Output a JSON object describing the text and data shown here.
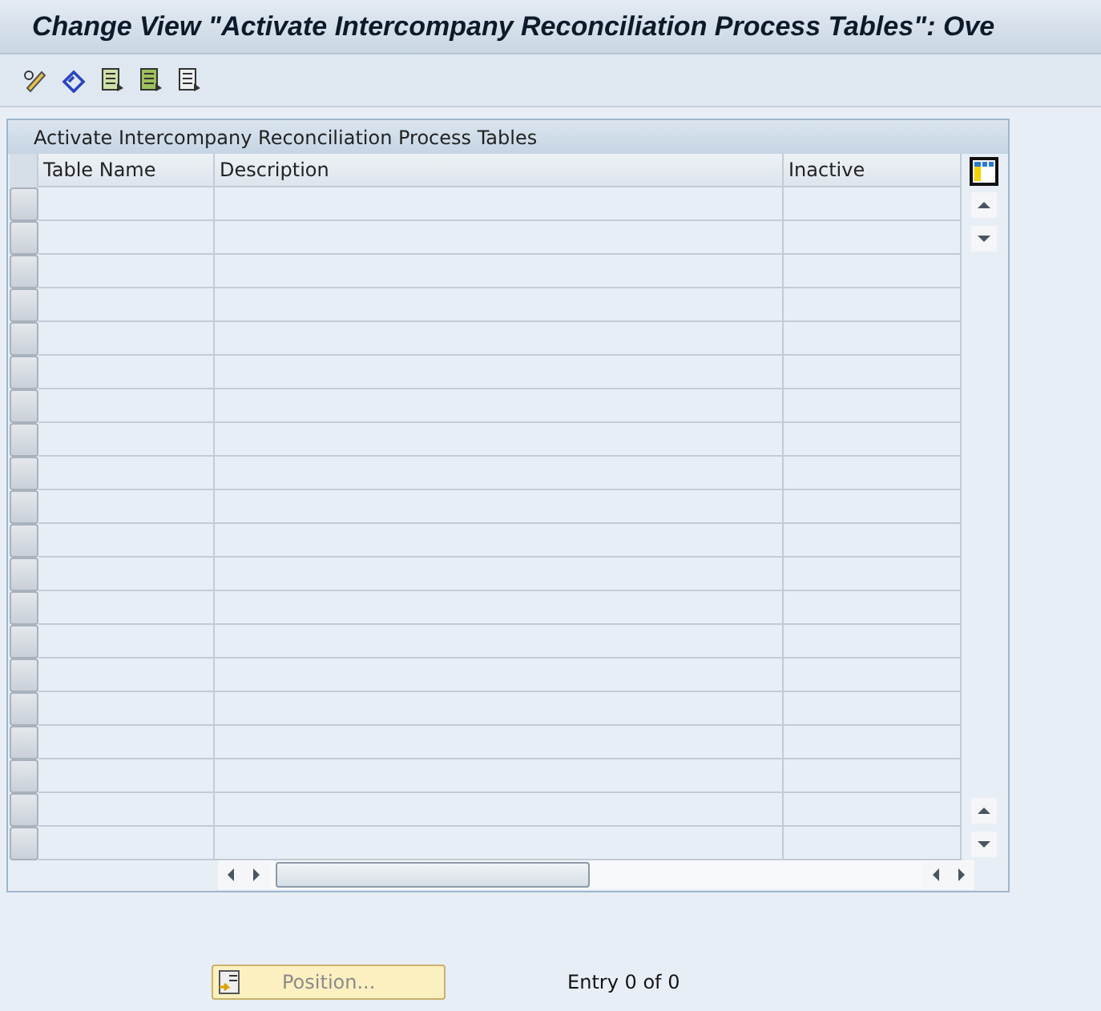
{
  "window": {
    "title": "Change View \"Activate Intercompany Reconciliation Process Tables\": Ove"
  },
  "table": {
    "title": "Activate Intercompany Reconciliation Process Tables",
    "columns": [
      "Table Name",
      "Description",
      "Inactive"
    ]
  },
  "position_button": {
    "label": "Position...",
    "disabled": true
  },
  "entry_count": "Entry 0 of 0"
}
